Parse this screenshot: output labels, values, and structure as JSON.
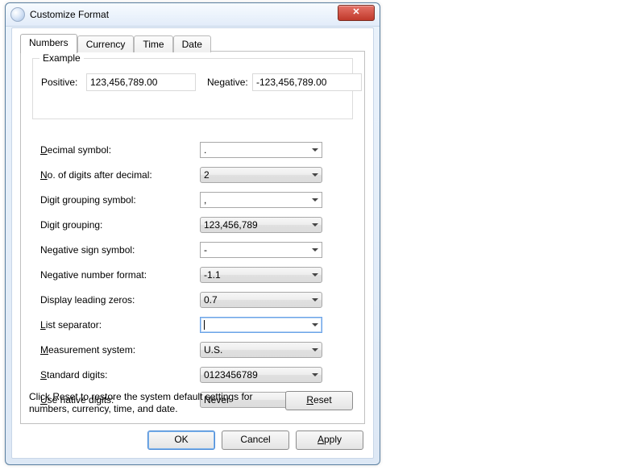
{
  "title": "Customize Format",
  "tabs": {
    "numbers": "Numbers",
    "currency": "Currency",
    "time": "Time",
    "date": "Date"
  },
  "example": {
    "legend": "Example",
    "positive_label": "Positive:",
    "positive_value": "123,456,789.00",
    "negative_label": "Negative:",
    "negative_value": "-123,456,789.00"
  },
  "rows": {
    "decimal_symbol": {
      "label_pre": "",
      "label_ul": "D",
      "label_post": "ecimal symbol:",
      "value": ".",
      "style": "flat"
    },
    "num_digits": {
      "label_pre": "",
      "label_ul": "N",
      "label_post": "o. of digits after decimal:",
      "value": "2",
      "style": "combo"
    },
    "grouping_sym": {
      "label": "Digit grouping symbol:",
      "value": ",",
      "style": "flat"
    },
    "grouping": {
      "label": "Digit grouping:",
      "value": "123,456,789",
      "style": "combo"
    },
    "neg_sign": {
      "label": "Negative sign symbol:",
      "value": "-",
      "style": "flat"
    },
    "neg_format": {
      "label": "Negative number format:",
      "value": "-1.1",
      "style": "combo"
    },
    "leading_zeros": {
      "label": "Display leading zeros:",
      "value": "0.7",
      "style": "combo"
    },
    "list_sep": {
      "label_pre": "",
      "label_ul": "L",
      "label_post": "ist separator:",
      "value": "",
      "style": "focus"
    },
    "measurement": {
      "label_pre": "",
      "label_ul": "M",
      "label_post": "easurement system:",
      "value": "U.S.",
      "style": "combo"
    },
    "std_digits": {
      "label_pre": "",
      "label_ul": "S",
      "label_post": "tandard digits:",
      "value": "0123456789",
      "style": "combo"
    },
    "native_digits": {
      "label_pre": "",
      "label_ul": "U",
      "label_post": "se native digits:",
      "value": "Never",
      "style": "combo"
    }
  },
  "reset": {
    "text": "Click Reset to restore the system default settings for numbers, currency, time, and date.",
    "button_pre": "",
    "button_ul": "R",
    "button_post": "eset"
  },
  "buttons": {
    "ok": "OK",
    "cancel": "Cancel",
    "apply_pre": "",
    "apply_ul": "A",
    "apply_post": "pply"
  }
}
